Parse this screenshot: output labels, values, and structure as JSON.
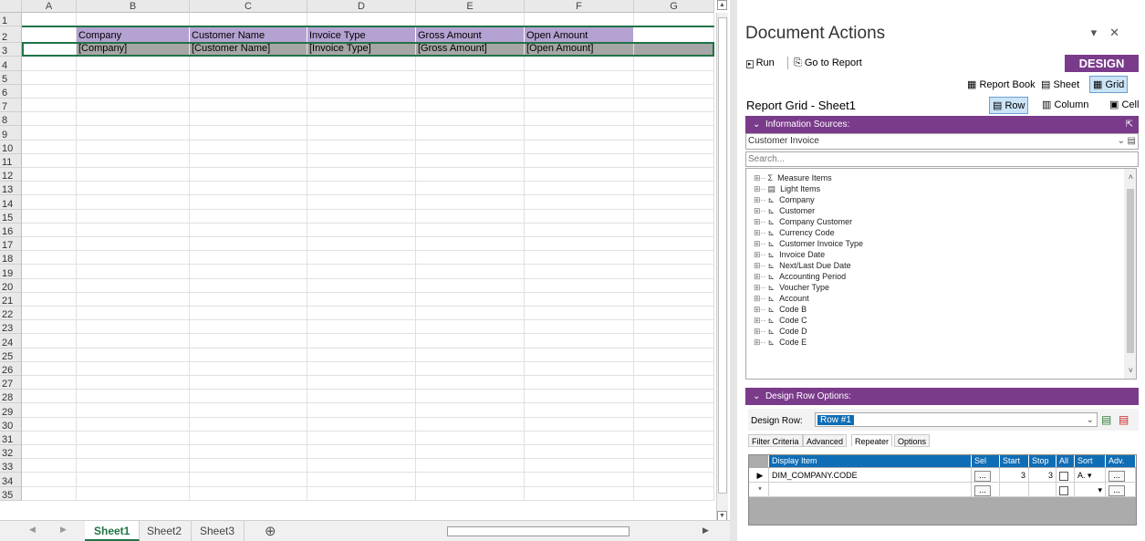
{
  "sheet": {
    "columns": [
      "A",
      "B",
      "C",
      "D",
      "E",
      "F",
      "G"
    ],
    "rows": [
      "1",
      "2",
      "3",
      "4",
      "5",
      "6",
      "7",
      "8",
      "9",
      "10",
      "11",
      "12",
      "13",
      "14",
      "15",
      "16",
      "17",
      "18",
      "19",
      "20",
      "21",
      "22",
      "23",
      "24",
      "25",
      "26",
      "27",
      "28",
      "29",
      "30",
      "31",
      "32",
      "33",
      "34",
      "35"
    ],
    "header_row": [
      "Company",
      "Customer Name",
      "Invoice Type",
      "Gross Amount",
      "Open Amount"
    ],
    "data_row": [
      "[Company]",
      "[Customer Name]",
      "[Invoice Type]",
      "[Gross Amount]",
      "[Open Amount]"
    ],
    "tabs": [
      "Sheet1",
      "Sheet2",
      "Sheet3"
    ],
    "add_sheet_icon": "⊕",
    "colors": {
      "header_fill": "#b4a2d2",
      "row3_fill": "#a6a6a6",
      "accent": "#217346"
    }
  },
  "panel": {
    "title": "Document Actions",
    "run_label": "Run",
    "goto_label": "Go to Report",
    "design_mode": "DESIGN MODE",
    "report_book": "Report Book",
    "sheet": "Sheet",
    "grid": "Grid",
    "report_grid_title": "Report Grid - Sheet1",
    "row": "Row",
    "column": "Column",
    "cell": "Cell",
    "info_sources": "Information Sources:",
    "source_value": "Customer Invoice",
    "search_placeholder": "Search...",
    "tree_items": [
      {
        "icon": "Σ",
        "label": "Measure Items"
      },
      {
        "icon": "▤",
        "label": "Light Items"
      },
      {
        "icon": "⊾",
        "label": "Company"
      },
      {
        "icon": "⊾",
        "label": "Customer"
      },
      {
        "icon": "⊾",
        "label": "Company Customer"
      },
      {
        "icon": "⊾",
        "label": "Currency Code"
      },
      {
        "icon": "⊾",
        "label": "Customer Invoice Type"
      },
      {
        "icon": "⊾",
        "label": "Invoice Date"
      },
      {
        "icon": "⊾",
        "label": "Next/Last Due Date"
      },
      {
        "icon": "⊾",
        "label": "Accounting Period"
      },
      {
        "icon": "⊾",
        "label": "Voucher Type"
      },
      {
        "icon": "⊾",
        "label": "Account"
      },
      {
        "icon": "⊾",
        "label": "Code B"
      },
      {
        "icon": "⊾",
        "label": "Code C"
      },
      {
        "icon": "⊾",
        "label": "Code D"
      },
      {
        "icon": "⊾",
        "label": "Code E"
      }
    ],
    "design_row_options": "Design Row Options:",
    "design_row_label": "Design Row:",
    "design_row_value": "Row #1",
    "subtabs": [
      "Filter Criteria",
      "Advanced",
      "Repeater",
      "Options"
    ],
    "grid_headers": [
      "Display Item",
      "Sel",
      "Start",
      "Stop",
      "All",
      "Sort",
      "Adv."
    ],
    "grid_row": {
      "item": "DIM_COMPANY.CODE",
      "start": "3",
      "stop": "3",
      "sort": "A."
    },
    "dots": "...",
    "purple": "#7a3b8b"
  }
}
